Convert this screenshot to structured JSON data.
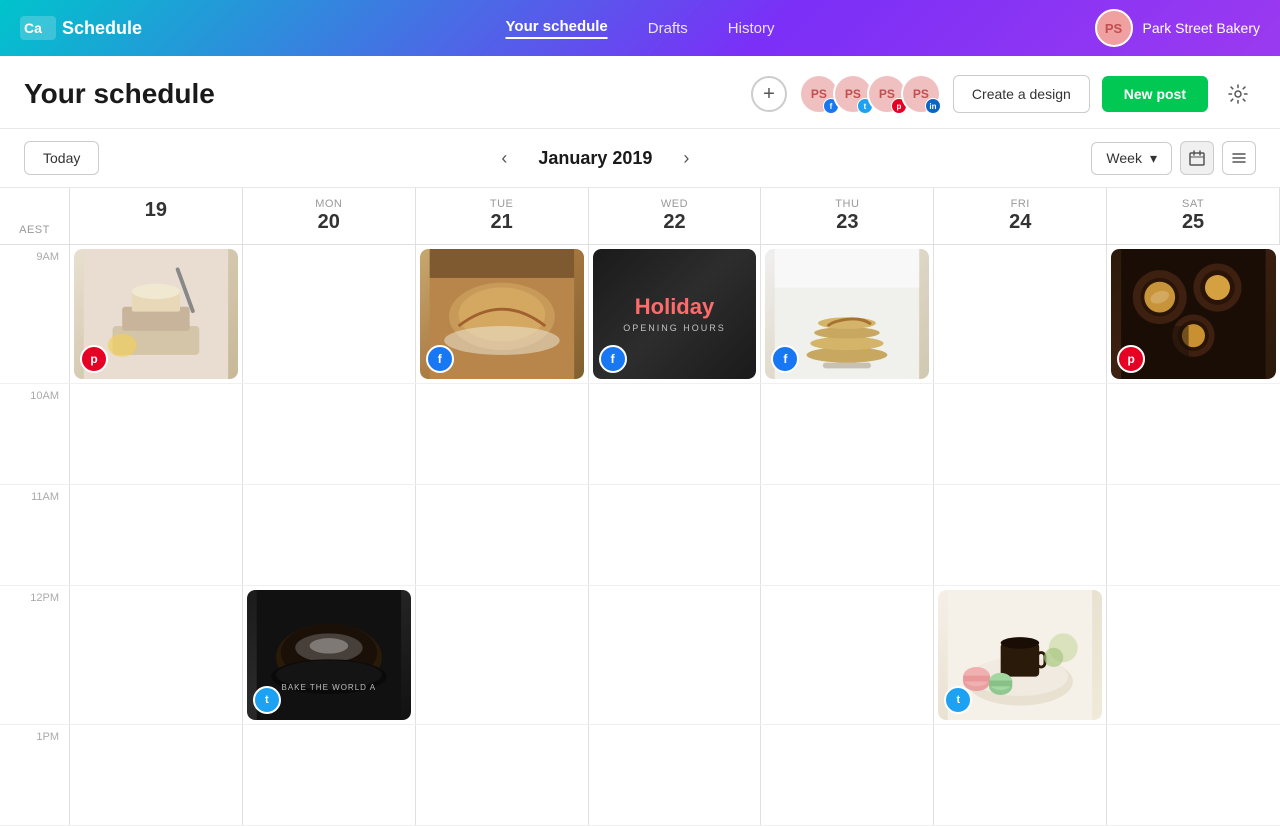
{
  "header": {
    "logo": "Canva",
    "logo_sub": "Schedule",
    "nav": [
      {
        "label": "Your schedule",
        "active": true
      },
      {
        "label": "Drafts",
        "active": false
      },
      {
        "label": "History",
        "active": false
      }
    ],
    "user_initials": "PS",
    "user_name": "Park Street Bakery"
  },
  "page": {
    "title": "Your schedule"
  },
  "sub_header": {
    "add_label": "+",
    "create_btn": "Create a design",
    "new_post_btn": "New post",
    "social_accounts": [
      {
        "initials": "PS",
        "platform": "fb",
        "platform_label": "f"
      },
      {
        "initials": "PS",
        "platform": "tw",
        "platform_label": "t"
      },
      {
        "initials": "PS",
        "platform": "pt",
        "platform_label": "p"
      },
      {
        "initials": "PS",
        "platform": "li",
        "platform_label": "in"
      }
    ]
  },
  "calendar": {
    "today_btn": "Today",
    "month": "January 2019",
    "view": "Week",
    "aest_label": "AEST",
    "days": [
      {
        "name": "",
        "num": "19",
        "day_abbr": ""
      },
      {
        "name": "Mon",
        "num": "20"
      },
      {
        "name": "Tue",
        "num": "21"
      },
      {
        "name": "Wed",
        "num": "22"
      },
      {
        "name": "Thu",
        "num": "23"
      },
      {
        "name": "Fri",
        "num": "24"
      },
      {
        "name": "Sat",
        "num": "25"
      }
    ],
    "time_slots": [
      "9AM",
      "10AM",
      "11AM",
      "12PM",
      "1PM"
    ]
  }
}
